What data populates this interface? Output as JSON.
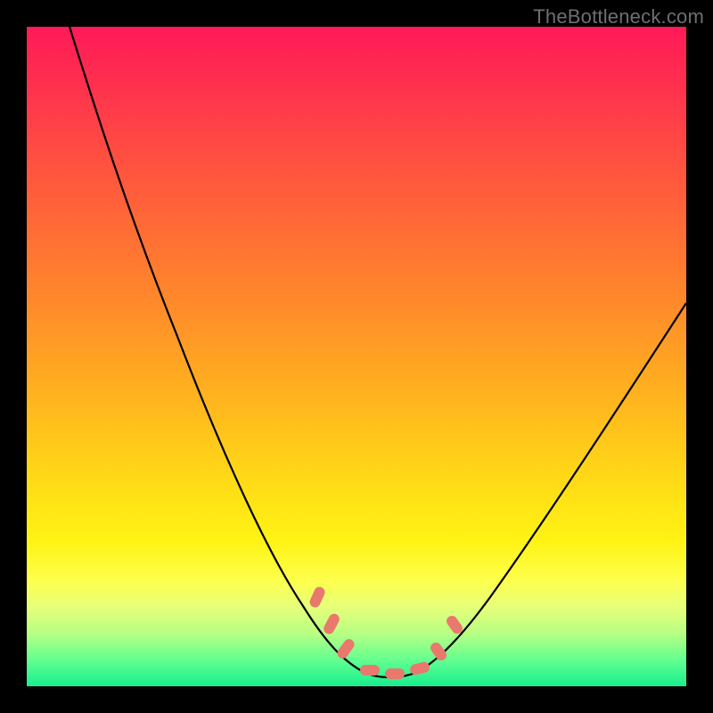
{
  "watermark": "TheBottleneck.com",
  "colors": {
    "background": "#000000",
    "gradient_top": "#ff1a58",
    "gradient_mid": "#ffd817",
    "gradient_bottom": "#17ee8f",
    "curve": "#000000",
    "marker": "#e9786d"
  },
  "chart_data": {
    "type": "line",
    "title": "",
    "xlabel": "",
    "ylabel": "",
    "xlim": [
      0,
      100
    ],
    "ylim": [
      0,
      100
    ],
    "grid": false,
    "legend": false,
    "series": [
      {
        "name": "bottleneck-curve",
        "x": [
          5,
          10,
          15,
          20,
          25,
          30,
          35,
          40,
          43,
          46,
          49,
          52,
          55,
          58,
          60,
          65,
          70,
          75,
          80,
          85,
          90,
          95,
          100
        ],
        "values": [
          100,
          88,
          77,
          66,
          56,
          46,
          36,
          26,
          19,
          12,
          6,
          2,
          1,
          1,
          2,
          7,
          14,
          22,
          30,
          38,
          46,
          53,
          60
        ]
      }
    ],
    "markers": [
      {
        "label": "p1",
        "x": 44,
        "y": 15
      },
      {
        "label": "p2",
        "x": 46,
        "y": 11
      },
      {
        "label": "p3",
        "x": 48,
        "y": 7
      },
      {
        "label": "p4",
        "x": 51,
        "y": 2
      },
      {
        "label": "p5",
        "x": 55,
        "y": 1
      },
      {
        "label": "p6",
        "x": 58,
        "y": 2
      },
      {
        "label": "p7",
        "x": 61,
        "y": 6
      },
      {
        "label": "p8",
        "x": 63,
        "y": 10
      }
    ],
    "note": "x and y in percent of plot area; curve is a V/well shape reaching ~0 near x≈55 then rising; right branch terminates ≈60% height at right edge."
  }
}
